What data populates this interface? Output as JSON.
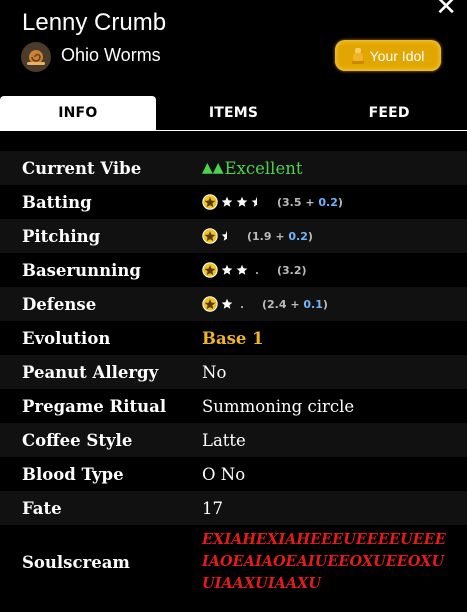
{
  "header": {
    "player_name": "Lenny Crumb",
    "team_name": "Ohio Worms",
    "team_icon": "snail-emoji-icon",
    "idol_button_label": "Your Idol",
    "close_icon": "close-icon"
  },
  "tabs": [
    {
      "label": "INFO",
      "active": true
    },
    {
      "label": "ITEMS",
      "active": false
    },
    {
      "label": "FEED",
      "active": false
    }
  ],
  "rows": {
    "vibe": {
      "label": "Current Vibe",
      "value": "Excellent"
    },
    "batting": {
      "label": "Batting",
      "stars": 3.5,
      "rating": "(3.5 + ",
      "bonus": "0.2",
      "close": ")"
    },
    "pitching": {
      "label": "Pitching",
      "stars": 1.9,
      "rating": "(1.9 + ",
      "bonus": "0.2",
      "close": ")"
    },
    "baserunning": {
      "label": "Baserunning",
      "stars": 3.2,
      "rating": "(3.2)"
    },
    "defense": {
      "label": "Defense",
      "stars": 2.4,
      "rating": "(2.4 + ",
      "bonus": "0.1",
      "close": ")"
    },
    "evolution": {
      "label": "Evolution",
      "value": "Base 1"
    },
    "peanut": {
      "label": "Peanut Allergy",
      "value": "No"
    },
    "ritual": {
      "label": "Pregame Ritual",
      "value": "Summoning circle"
    },
    "coffee": {
      "label": "Coffee Style",
      "value": "Latte"
    },
    "blood": {
      "label": "Blood Type",
      "value": "O No"
    },
    "fate": {
      "label": "Fate",
      "value": "17"
    },
    "soulscream": {
      "label": "Soulscream",
      "value": "EXIAHEXIAHEEEUEEEEUEEEIAOEAIAOEAIUEEOXUEEOXUUIAAXUIAAXU"
    }
  },
  "colors": {
    "vibe_green": "#4cd34c",
    "evolution_gold": "#f0b428",
    "soulscream_red": "#e51b1b",
    "idol_gold": "#e2a600",
    "bonus_blue": "#6eb6ff"
  }
}
